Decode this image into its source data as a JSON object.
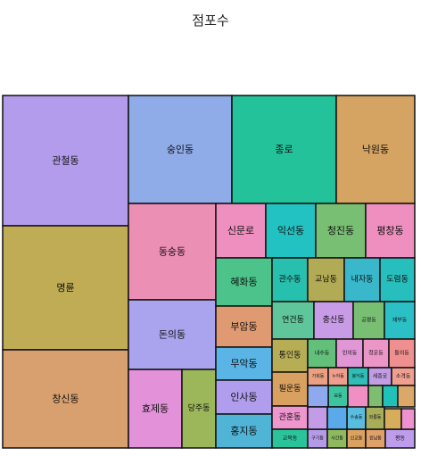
{
  "chart_data": {
    "type": "treemap",
    "title": "점포수",
    "tiles": [
      {
        "label": "관철동",
        "color": "#b39ceb"
      },
      {
        "label": "명륜",
        "color": "#c0ac55"
      },
      {
        "label": "창신동",
        "color": "#d9a06f"
      },
      {
        "label": "숭인동",
        "color": "#8fabe8"
      },
      {
        "label": "동숭동",
        "color": "#ec8fb5"
      },
      {
        "label": "돈의동",
        "color": "#a9a4ed"
      },
      {
        "label": "효제동",
        "color": "#e391d8"
      },
      {
        "label": "당주동",
        "color": "#9bb75a"
      },
      {
        "label": "종로",
        "color": "#23c29a"
      },
      {
        "label": "낙원동",
        "color": "#d5a362"
      },
      {
        "label": "신문로",
        "color": "#ee8fc0"
      },
      {
        "label": "익선동",
        "color": "#23c2c2"
      },
      {
        "label": "청진동",
        "color": "#78bf73"
      },
      {
        "label": "평창동",
        "color": "#ef8fbf"
      },
      {
        "label": "혜화동",
        "color": "#4cc38a"
      },
      {
        "label": "관수동",
        "color": "#27bfae"
      },
      {
        "label": "교남동",
        "color": "#b2ab55"
      },
      {
        "label": "내자동",
        "color": "#39b8cc"
      },
      {
        "label": "도렴동",
        "color": "#27bfbd"
      },
      {
        "label": "부암동",
        "color": "#e09a72"
      },
      {
        "label": "연건동",
        "color": "#5fc59a"
      },
      {
        "label": "충신동",
        "color": "#c79be6"
      },
      {
        "label": "공평동",
        "color": "#78bf73"
      },
      {
        "label": "재부동",
        "color": "#2bc0c6"
      },
      {
        "label": "무악동",
        "color": "#5ab4e6"
      },
      {
        "label": "인사동",
        "color": "#b19ded"
      },
      {
        "label": "홍지동",
        "color": "#4fb4d6"
      },
      {
        "label": "통인동",
        "color": "#b6ad55"
      },
      {
        "label": "필운동",
        "color": "#d8a15f"
      },
      {
        "label": "관훈동",
        "color": "#ef96cf"
      },
      {
        "label": "교북동",
        "color": "#2bc49a"
      },
      {
        "label": "내수동",
        "color": "#62c07a"
      },
      {
        "label": "인의동",
        "color": "#e196d6"
      },
      {
        "label": "청운동",
        "color": "#ec96c8"
      },
      {
        "label": "통의동",
        "color": "#ef8f8f"
      },
      {
        "label": "가회동",
        "color": "#e9a182"
      },
      {
        "label": "누하동",
        "color": "#ef9e8e"
      },
      {
        "label": "봉익동",
        "color": "#2fbdb6"
      },
      {
        "label": "세종로",
        "color": "#c29de4"
      },
      {
        "label": "소격동",
        "color": "#ef9f8f"
      },
      {
        "label": "묘동",
        "color": "#3dc49e"
      },
      {
        "label": "구기동",
        "color": "#b49be8"
      },
      {
        "label": "사간동",
        "color": "#8fb95f"
      },
      {
        "label": "신교동",
        "color": "#d9a261"
      },
      {
        "label": "원남동",
        "color": "#dfa06a"
      },
      {
        "label": "수송동",
        "color": "#5abde0"
      },
      {
        "label": "와룡동",
        "color": "#a8ad5a"
      },
      {
        "label": "평동",
        "color": "#bd9deb"
      },
      {
        "label": "",
        "color": "#8fa9ef"
      },
      {
        "label": "",
        "color": "#f08fc4"
      },
      {
        "label": "",
        "color": "#7fbd70"
      },
      {
        "label": "",
        "color": "#1fc1b8"
      },
      {
        "label": "",
        "color": "#dba86a"
      },
      {
        "label": "",
        "color": "#c49be6"
      },
      {
        "label": "",
        "color": "#5aa9e8"
      },
      {
        "label": "",
        "color": "#d7ad5b"
      },
      {
        "label": "",
        "color": "#ee92cf"
      },
      {
        "label": "",
        "color": "#f08fb0"
      },
      {
        "label": "",
        "color": "#d2a3e6"
      },
      {
        "label": "",
        "color": "#1fbfa0"
      },
      {
        "label": "",
        "color": "#bfb25a"
      }
    ]
  }
}
